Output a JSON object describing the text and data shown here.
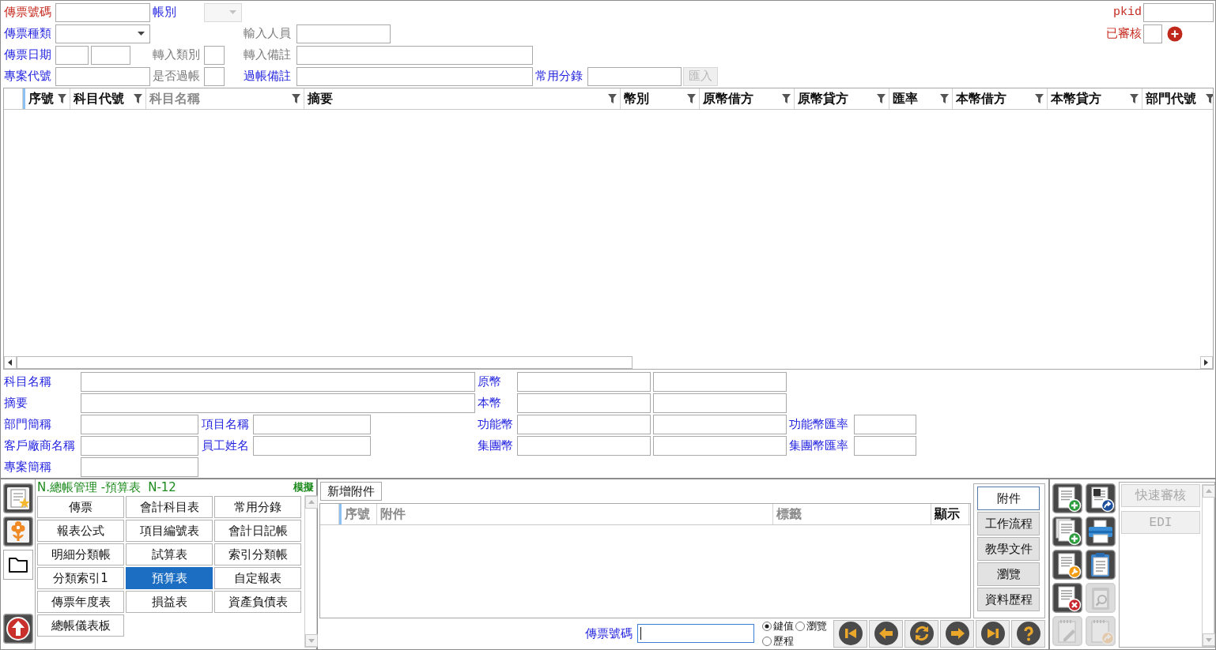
{
  "voucher_form": {
    "rows": [
      {
        "fields": [
          {
            "label": {
              "text": "傳票號碼",
              "kind": "required"
            },
            "kind": "text",
            "disabled": false
          },
          {
            "label": {
              "text": "帳別",
              "kind": "lookup"
            },
            "kind": "select",
            "disabled": true
          }
        ]
      },
      {
        "fields": [
          {
            "label": {
              "text": "傳票種類",
              "kind": "lookup"
            },
            "kind": "select",
            "disabled": false
          },
          {
            "label": {
              "text": "輸入人員",
              "kind": "plain"
            },
            "kind": "text",
            "disabled": false
          }
        ]
      },
      {
        "fields": [
          {
            "label": {
              "text": "傳票日期",
              "kind": "lookup"
            },
            "kind": "daterange",
            "disabled": false
          },
          {
            "label": {
              "text": "轉入類別",
              "kind": "plain"
            },
            "kind": "text",
            "disabled": false
          },
          {
            "label": {
              "text": "轉入備註",
              "kind": "plain"
            },
            "kind": "text",
            "disabled": false
          }
        ]
      },
      {
        "fields": [
          {
            "label": {
              "text": "專案代號",
              "kind": "lookup"
            },
            "kind": "text",
            "disabled": false
          },
          {
            "label": {
              "text": "是否過帳",
              "kind": "plain"
            },
            "kind": "text",
            "disabled": false
          },
          {
            "label": {
              "text": "過帳備註",
              "kind": "lookup"
            },
            "kind": "text",
            "disabled": false
          },
          {
            "label": {
              "text": "常用分錄",
              "kind": "lookup"
            },
            "kind": "text",
            "disabled": false
          }
        ]
      }
    ],
    "import_button": {
      "label": "匯入",
      "disabled": true
    },
    "status_fields": [
      {
        "label": {
          "text": "pkid",
          "kind": "required"
        },
        "kind": "text",
        "disabled": false
      },
      {
        "label": {
          "text": "已審核",
          "kind": "required"
        },
        "kind": "check",
        "disabled": false
      }
    ]
  },
  "entries_table": {
    "columns": [
      {
        "title": "序號",
        "dimmed": false
      },
      {
        "title": "科目代號",
        "dimmed": false
      },
      {
        "title": "科目名稱",
        "dimmed": true
      },
      {
        "title": "摘要",
        "dimmed": false
      },
      {
        "title": "幣別",
        "dimmed": false
      },
      {
        "title": "原幣借方",
        "dimmed": false
      },
      {
        "title": "原幣貸方",
        "dimmed": false
      },
      {
        "title": "匯率",
        "dimmed": false
      },
      {
        "title": "本幣借方",
        "dimmed": false
      },
      {
        "title": "本幣貸方",
        "dimmed": false
      },
      {
        "title": "部門代號",
        "dimmed": false
      }
    ]
  },
  "detail_form": {
    "rows": [
      [
        {
          "label": "科目名稱",
          "kind": "wide"
        },
        {
          "label": "原幣",
          "kind": "double"
        }
      ],
      [
        {
          "label": "摘要",
          "kind": "wide"
        },
        {
          "label": "本幣",
          "kind": "double"
        }
      ],
      [
        {
          "label": "部門簡稱",
          "kind": "single"
        },
        {
          "label": "項目名稱",
          "kind": "single"
        },
        {
          "label": "功能幣",
          "kind": "double"
        },
        {
          "label": "功能幣匯率",
          "kind": "single"
        }
      ],
      [
        {
          "label": "客戶廠商名稱",
          "kind": "single"
        },
        {
          "label": "員工姓名",
          "kind": "single"
        },
        {
          "label": "集團幣",
          "kind": "double"
        },
        {
          "label": "集團幣匯率",
          "kind": "single"
        }
      ],
      [
        {
          "label": "專案簡稱",
          "kind": "single"
        }
      ]
    ]
  },
  "module_panel": {
    "rail": [
      {
        "kind": "favorites",
        "selected": false
      },
      {
        "kind": "flower",
        "selected": false
      },
      {
        "kind": "folder",
        "selected": true
      }
    ],
    "title": "N.總帳管理 -預算表",
    "code": "N-12",
    "mode": "模擬",
    "items": [
      {
        "label": "傳票",
        "selected": false
      },
      {
        "label": "會計科目表",
        "selected": false
      },
      {
        "label": "常用分錄",
        "selected": false
      },
      {
        "label": "報表公式",
        "selected": false
      },
      {
        "label": "項目編號表",
        "selected": false
      },
      {
        "label": "會計日記帳",
        "selected": false
      },
      {
        "label": "明細分類帳",
        "selected": false
      },
      {
        "label": "試算表",
        "selected": false
      },
      {
        "label": "索引分類帳",
        "selected": false
      },
      {
        "label": "分類索引1",
        "selected": false
      },
      {
        "label": "預算表",
        "selected": true
      },
      {
        "label": "自定報表",
        "selected": false
      },
      {
        "label": "傳票年度表",
        "selected": false
      },
      {
        "label": "損益表",
        "selected": false
      },
      {
        "label": "資產負債表",
        "selected": false
      },
      {
        "label": "總帳儀表板",
        "selected": false
      }
    ]
  },
  "attachments": {
    "add_button": "新增附件",
    "columns": [
      {
        "title": "序號",
        "dimmed": true
      },
      {
        "title": "附件",
        "dimmed": true
      },
      {
        "title": "標籤",
        "dimmed": true
      },
      {
        "title": "顯示",
        "dimmed": false
      }
    ],
    "tabs": [
      {
        "label": "附件",
        "selected": true
      },
      {
        "label": "工作流程",
        "selected": false
      },
      {
        "label": "教學文件",
        "selected": false
      },
      {
        "label": "瀏覽",
        "selected": false
      },
      {
        "label": "資料歷程",
        "selected": false
      }
    ]
  },
  "record_search": {
    "label": "傳票號碼",
    "focused": true,
    "modes": [
      {
        "label": "鍵值",
        "selected": true
      },
      {
        "label": "瀏覽",
        "selected": false
      },
      {
        "label": "歷程",
        "selected": false
      }
    ]
  },
  "toolbar": [
    {
      "kind": "new",
      "disabled": false
    },
    {
      "kind": "export",
      "disabled": false
    },
    {
      "kind": "copy",
      "disabled": false
    },
    {
      "kind": "print",
      "disabled": false
    },
    {
      "kind": "edit",
      "disabled": false
    },
    {
      "kind": "paste",
      "disabled": false
    },
    {
      "kind": "delete",
      "disabled": false
    },
    {
      "kind": "find",
      "disabled": true
    },
    {
      "kind": "note",
      "disabled": true
    },
    {
      "kind": "forward",
      "disabled": true
    }
  ],
  "quick_actions": [
    {
      "label": "快速審核",
      "disabled": true
    },
    {
      "label": "EDI",
      "disabled": true
    }
  ]
}
